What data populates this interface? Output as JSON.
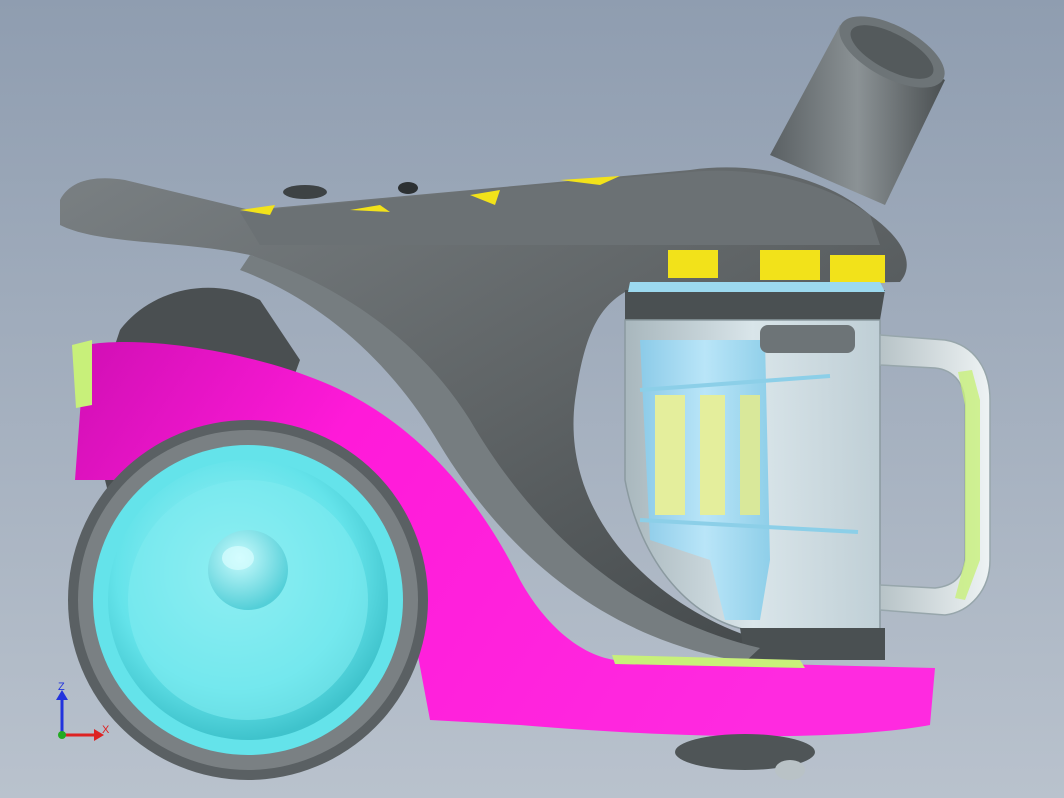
{
  "viewport": {
    "background_top": "#8f9db0",
    "background_bottom": "#b9c2cd"
  },
  "model": {
    "colors": {
      "body_gray": "#5f6466",
      "body_gray_dark": "#3f4446",
      "body_gray_light": "#80878a",
      "wheel_cover_magenta": "#ff1ad9",
      "wheel_cover_magenta_dark": "#d00fb4",
      "wheel_cyan": "#64e3ea",
      "wheel_cyan_light": "#a6f3f6",
      "dust_bin_transparent": "#c9dde3",
      "filter_light_blue": "#a9dcf5",
      "filter_yellow": "#e4ee9c",
      "accent_yellow": "#f2e21a",
      "accent_green": "#c8f07a",
      "handle_light": "#e8eef0"
    }
  },
  "triad": {
    "axes": [
      {
        "label": "Z",
        "color": "#2233dd",
        "icon": "axis-z-arrow"
      },
      {
        "label": "X",
        "color": "#dd2222",
        "icon": "axis-x-arrow"
      },
      {
        "label": "",
        "color": "#22aa22",
        "icon": "axis-y-dot"
      }
    ]
  }
}
